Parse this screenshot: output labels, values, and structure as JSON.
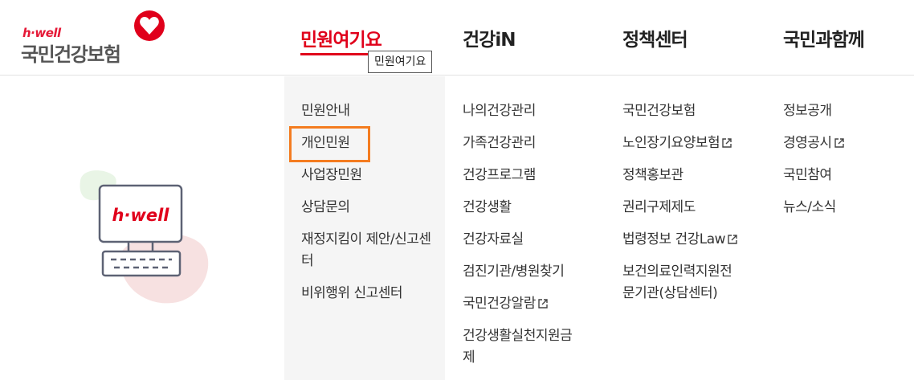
{
  "logo": {
    "tagline": "h·well",
    "name": "국민건강보험"
  },
  "gnb": [
    {
      "label": "민원여기요",
      "active": true
    },
    {
      "label": "건강iN"
    },
    {
      "label": "정책센터"
    },
    {
      "label": "국민과함께"
    }
  ],
  "tooltip": "민원여기요",
  "columns": {
    "col1": [
      "민원안내",
      "개인민원",
      "사업장민원",
      "상담문의",
      "재정지킴이 제안/신고센터",
      "비위행위 신고센터"
    ],
    "col2": [
      "나의건강관리",
      "가족건강관리",
      "건강프로그램",
      "건강생활",
      "건강자료실",
      "검진기관/병원찾기",
      "국민건강알람",
      "건강생활실천지원금제"
    ],
    "col3": [
      "국민건강보험",
      "노인장기요양보험",
      "정책홍보관",
      "권리구제제도",
      "법령정보 건강Law",
      "보건의료인력지원전문기관(상담센터)"
    ],
    "col4": [
      "정보공개",
      "경영공시",
      "국민참여",
      "뉴스/소식"
    ]
  },
  "illustration": {
    "screen_text": "h·well"
  },
  "colors": {
    "accent": "#e0001b",
    "highlight": "#f47c20",
    "panel_bg": "#f5f5f5"
  },
  "icons": {
    "external_link": "external-link-icon",
    "heart": "heart-icon"
  }
}
